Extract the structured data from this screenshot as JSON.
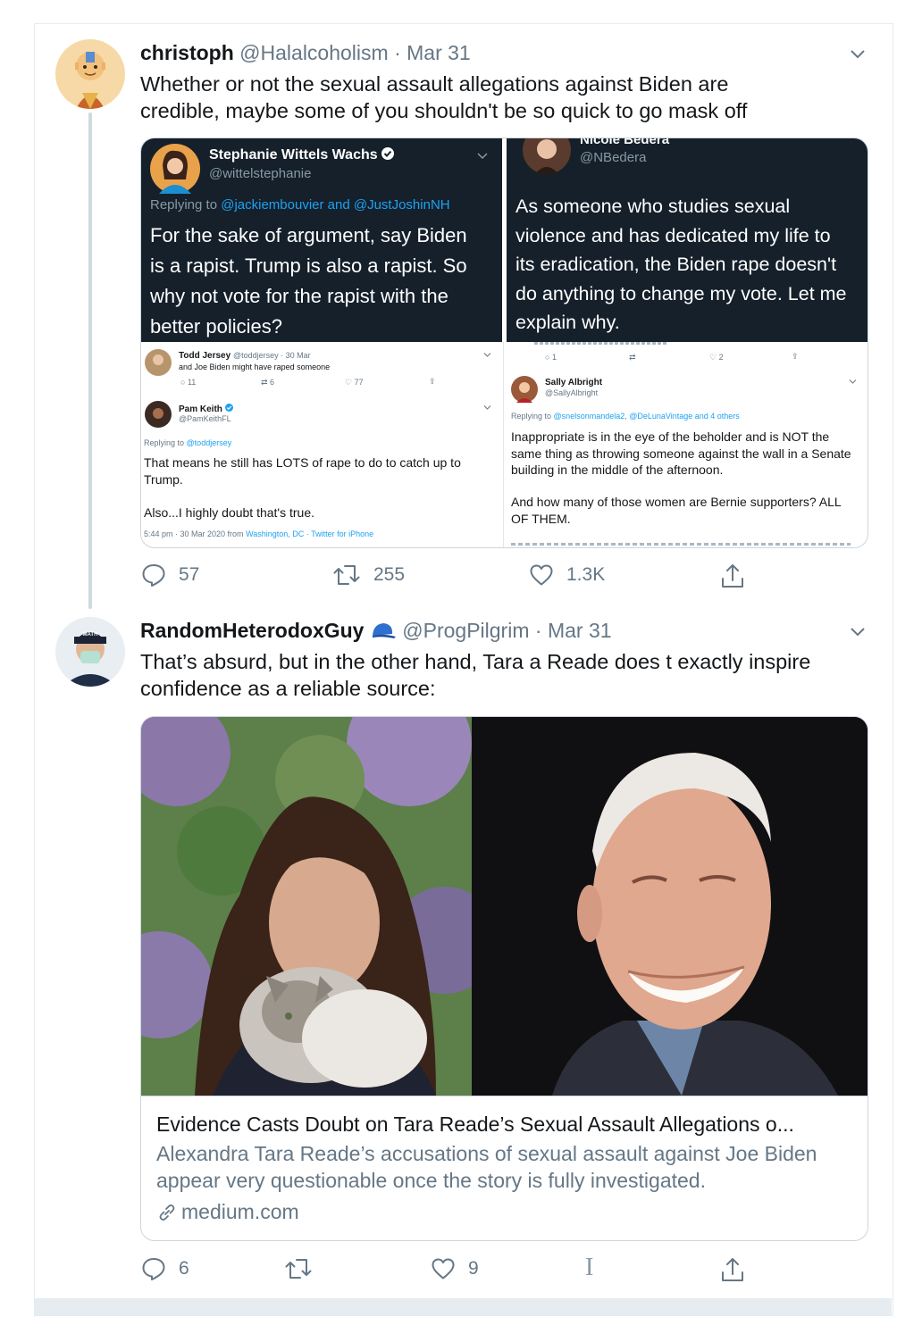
{
  "tweet1": {
    "name": "christoph",
    "handle": "@Halalcoholism",
    "date": "Mar 31",
    "text_line1": "Whether or not the sexual assault allegations against Biden are",
    "text_line2": "credible, maybe some of you shouldn't be so quick to go mask off",
    "screenshot": {
      "left_dark": {
        "name": "Stephanie Wittels Wachs",
        "handle": "@wittelstephanie",
        "replying_prefix": "Replying to",
        "replying_links": "@jackiembouvier and @JustJoshinNH",
        "body_lines": [
          "For the sake of argument, say Biden",
          "is a rapist. Trump is also a rapist. So",
          "why not vote for the rapist with the",
          "better policies?"
        ]
      },
      "right_dark": {
        "name_partial": "Nicole Bedera",
        "handle": "@NBedera",
        "body_lines": [
          "As someone who studies sexual",
          "violence and has dedicated my life to",
          "its eradication, the Biden rape doesn't",
          "do anything to change my vote. Let me",
          "explain why."
        ]
      },
      "left_light": {
        "todd_name": "Todd Jersey",
        "todd_meta": "@toddjersey · 30 Mar",
        "todd_text": "and Joe Biden might have raped someone",
        "todd_replies": "11",
        "todd_retweets": "6",
        "todd_likes": "77",
        "pam_name": "Pam Keith",
        "pam_handle": "@PamKeithFL",
        "pam_replying_prefix": "Replying to",
        "pam_replying_link": "@toddjersey",
        "pam_text1": "That means he still has LOTS of rape to do to catch up to",
        "pam_text2": "Trump.",
        "pam_text3": "Also...I highly doubt that's true.",
        "pam_meta_time": "5:44 pm · 30 Mar 2020 from",
        "pam_meta_place": "Washington, DC · Twitter for iPhone"
      },
      "right_light": {
        "top_replies": "1",
        "top_likes": "2",
        "sally_name": "Sally Albright",
        "sally_handle": "@SallyAlbright",
        "sally_replying_prefix": "Replying to",
        "sally_replying_links": "@snelsonmandela2, @DeLunaVintage and 4 others",
        "sally_text_lines": [
          "Inappropriate is in the eye of the beholder and is NOT the",
          "same thing as throwing someone against the wall in a Senate",
          "building in the middle of the afternoon."
        ],
        "sally_text2_lines": [
          "And how many of those women are Bernie supporters? ALL",
          "OF THEM."
        ]
      }
    },
    "actions": {
      "replies": "57",
      "retweets": "255",
      "likes": "1.3K"
    }
  },
  "tweet2": {
    "name": "RandomHeterodoxGuy",
    "handle": "@ProgPilgrim",
    "date": "Mar 31",
    "avatar_hat_text": "MATH",
    "text_line1": "That’s absurd, but in the other hand, Tara a Reade does t exactly inspire",
    "text_line2": "confidence as a reliable source:",
    "card": {
      "title": "Evidence Casts Doubt on Tara Reade’s Sexual Assault Allegations o...",
      "desc": "Alexandra Tara Reade’s accusations of sexual assault against Joe Biden appear very questionable once the story is fully investigated.",
      "domain": "medium.com"
    },
    "actions": {
      "replies": "6",
      "likes": "9",
      "extra": "I"
    }
  },
  "colors": {
    "text": "#14171a",
    "muted": "#657786",
    "link": "#1da1f2",
    "dark_bg": "#15202b",
    "border": "#ccd6dd"
  }
}
